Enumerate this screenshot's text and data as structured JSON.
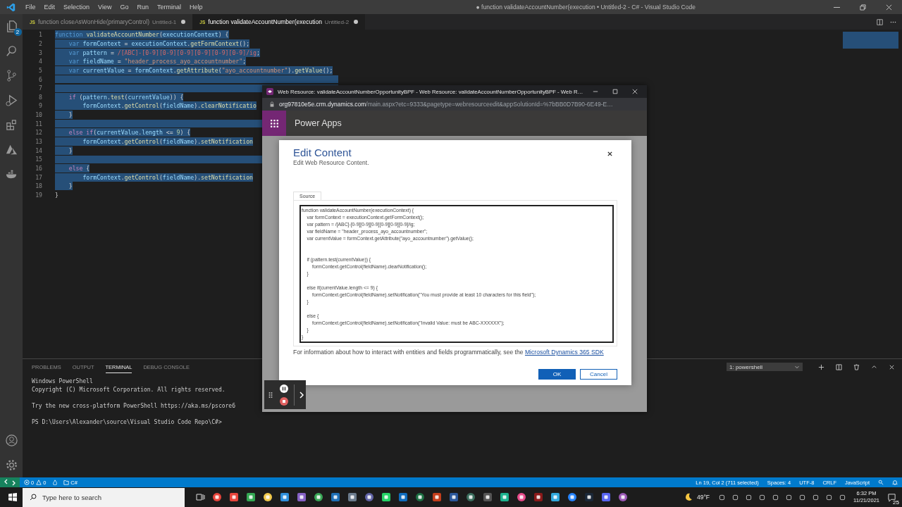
{
  "title_bar": {
    "menus": [
      "File",
      "Edit",
      "Selection",
      "View",
      "Go",
      "Run",
      "Terminal",
      "Help"
    ],
    "title": "● function validateAccountNumber(execution • Untitled-2 - C# - Visual Studio Code"
  },
  "activity_bar": {
    "explorer_badge": "2"
  },
  "editor": {
    "tabs": [
      {
        "badge": "JS",
        "label": "function closeAsWonHide(primaryControl)",
        "file": "Untitled-1",
        "modified": true,
        "selected": false
      },
      {
        "badge": "JS",
        "label": "function validateAccountNumber(execution",
        "file": "Untitled-2",
        "modified": true,
        "selected": true
      }
    ],
    "lines": [
      {
        "number": "1",
        "selected": true,
        "tokens": [
          {
            "kind": "kw",
            "text": "function "
          },
          {
            "kind": "fn",
            "text": "validateAccountNumber"
          },
          {
            "kind": "pl",
            "text": "("
          },
          {
            "kind": "var",
            "text": "executionContext"
          },
          {
            "kind": "pl",
            "text": ") {"
          }
        ]
      },
      {
        "number": "2",
        "selected": true,
        "tokens": [
          {
            "kind": "kw",
            "text": "    var "
          },
          {
            "kind": "var",
            "text": "formContext"
          },
          {
            "kind": "pl",
            "text": " = "
          },
          {
            "kind": "var",
            "text": "executionContext"
          },
          {
            "kind": "pl",
            "text": "."
          },
          {
            "kind": "fn",
            "text": "getFormContext"
          },
          {
            "kind": "pl",
            "text": "();"
          }
        ]
      },
      {
        "number": "3",
        "selected": true,
        "tokens": [
          {
            "kind": "kw",
            "text": "    var "
          },
          {
            "kind": "var",
            "text": "pattern"
          },
          {
            "kind": "pl",
            "text": " = "
          },
          {
            "kind": "re",
            "text": "/[ABC]-[0-9][0-9][0-9][0-9][0-9][0-9]/ig"
          },
          {
            "kind": "pl",
            "text": ";"
          }
        ]
      },
      {
        "number": "4",
        "selected": true,
        "tokens": [
          {
            "kind": "kw",
            "text": "    var "
          },
          {
            "kind": "var",
            "text": "fieldName"
          },
          {
            "kind": "pl",
            "text": " = "
          },
          {
            "kind": "str",
            "text": "\"header_process_ayo_accountnumber\""
          },
          {
            "kind": "pl",
            "text": ";"
          }
        ]
      },
      {
        "number": "5",
        "selected": true,
        "tokens": [
          {
            "kind": "kw",
            "text": "    var "
          },
          {
            "kind": "var",
            "text": "currentValue"
          },
          {
            "kind": "pl",
            "text": " = "
          },
          {
            "kind": "var",
            "text": "formContext"
          },
          {
            "kind": "pl",
            "text": "."
          },
          {
            "kind": "fn",
            "text": "getAttribute"
          },
          {
            "kind": "pl",
            "text": "("
          },
          {
            "kind": "str",
            "text": "\"ayo_accountnumber\""
          },
          {
            "kind": "pl",
            "text": ")."
          },
          {
            "kind": "fn",
            "text": "getValue"
          },
          {
            "kind": "pl",
            "text": "();"
          }
        ]
      },
      {
        "number": "6",
        "selected": true
      },
      {
        "number": "7",
        "selected": true
      },
      {
        "number": "8",
        "selected": true,
        "tokens": [
          {
            "kind": "ctl",
            "text": "    if"
          },
          {
            "kind": "pl",
            "text": " ("
          },
          {
            "kind": "var",
            "text": "pattern"
          },
          {
            "kind": "pl",
            "text": "."
          },
          {
            "kind": "fn",
            "text": "test"
          },
          {
            "kind": "pl",
            "text": "("
          },
          {
            "kind": "var",
            "text": "currentValue"
          },
          {
            "kind": "pl",
            "text": ")) {"
          }
        ]
      },
      {
        "number": "9",
        "selected": true,
        "tokens": [
          {
            "kind": "var",
            "text": "        formContext"
          },
          {
            "kind": "pl",
            "text": "."
          },
          {
            "kind": "fn",
            "text": "getControl"
          },
          {
            "kind": "pl",
            "text": "("
          },
          {
            "kind": "var",
            "text": "fieldName"
          },
          {
            "kind": "pl",
            "text": ")."
          },
          {
            "kind": "fn",
            "text": "clearNotificatio"
          }
        ]
      },
      {
        "number": "10",
        "selected": true,
        "tokens": [
          {
            "kind": "pl",
            "text": "    }"
          }
        ]
      },
      {
        "number": "11",
        "selected": true
      },
      {
        "number": "12",
        "selected": true,
        "tokens": [
          {
            "kind": "ctl",
            "text": "    else if"
          },
          {
            "kind": "pl",
            "text": "("
          },
          {
            "kind": "var",
            "text": "currentValue"
          },
          {
            "kind": "pl",
            "text": "."
          },
          {
            "kind": "var",
            "text": "length"
          },
          {
            "kind": "pl",
            "text": " <= "
          },
          {
            "kind": "num",
            "text": "9"
          },
          {
            "kind": "pl",
            "text": ") {"
          }
        ]
      },
      {
        "number": "13",
        "selected": true,
        "tokens": [
          {
            "kind": "var",
            "text": "        formContext"
          },
          {
            "kind": "pl",
            "text": "."
          },
          {
            "kind": "fn",
            "text": "getControl"
          },
          {
            "kind": "pl",
            "text": "("
          },
          {
            "kind": "var",
            "text": "fieldName"
          },
          {
            "kind": "pl",
            "text": ")."
          },
          {
            "kind": "fn",
            "text": "setNotification"
          }
        ]
      },
      {
        "number": "14",
        "selected": true,
        "tokens": [
          {
            "kind": "pl",
            "text": "    }"
          }
        ]
      },
      {
        "number": "15",
        "selected": true
      },
      {
        "number": "16",
        "selected": true,
        "tokens": [
          {
            "kind": "ctl",
            "text": "    else"
          },
          {
            "kind": "pl",
            "text": " {"
          }
        ]
      },
      {
        "number": "17",
        "selected": true,
        "tokens": [
          {
            "kind": "var",
            "text": "        formContext"
          },
          {
            "kind": "pl",
            "text": "."
          },
          {
            "kind": "fn",
            "text": "getControl"
          },
          {
            "kind": "pl",
            "text": "("
          },
          {
            "kind": "var",
            "text": "fieldName"
          },
          {
            "kind": "pl",
            "text": ")."
          },
          {
            "kind": "fn",
            "text": "setNotification"
          }
        ]
      },
      {
        "number": "18",
        "selected": true,
        "tokens": [
          {
            "kind": "pl",
            "text": "    }"
          }
        ]
      },
      {
        "number": "19",
        "selected": false,
        "tokens": [
          {
            "kind": "pl",
            "text": "}"
          }
        ]
      }
    ]
  },
  "browser_window": {
    "title": "Web Resource: validateAccountNumberOpportunityBPF - Web Resource: validateAccountNumberOpportunityBPF - Web R…",
    "host": "org97810e5e.crm.dynamics.com",
    "path": "/main.aspx?etc=9333&pagetype=webresourceedit&appSolutionId=%7bBB0D7B90-6E49-E…",
    "app_name": "Power Apps",
    "dialog": {
      "title": "Edit Content",
      "subtitle": "Edit Web Resource Content.",
      "tabs": [
        {
          "label": "Source",
          "selected": true
        }
      ],
      "code": "function validateAccountNumber(executionContext) {\n    var formContext = executionContext.getFormContext();\n    var pattern = /[ABC]-[0-9][0-9][0-9][0-9][0-9][0-9]/ig;\n    var fieldName = \"header_process_ayo_accountnumber\";\n    var currentValue = formContext.getAttribute(\"ayo_accountnumber\").getValue();\n\n\n    if (pattern.test(currentValue)) {\n        formContext.getControl(fieldName).clearNotification();\n    }\n\n    else if(currentValue.length <= 9) {\n        formContext.getControl(fieldName).setNotification(\"You must provide at least 10 characters for this field\");\n    }\n\n    else {\n        formContext.getControl(fieldName).setNotification(\"Invalid Value: must be ABC-XXXXXX\");\n    }\n}",
      "info": "For information about how to interact with entities and fields programmatically, see the",
      "link": "Microsoft Dynamics 365 SDK",
      "buttons": [
        {
          "label": "OK",
          "kind": "primary"
        },
        {
          "label": "Cancel",
          "kind": "secondary"
        }
      ]
    }
  },
  "panel": {
    "tabs": [
      {
        "label": "PROBLEMS",
        "selected": false
      },
      {
        "label": "OUTPUT",
        "selected": false
      },
      {
        "label": "TERMINAL",
        "selected": true
      },
      {
        "label": "DEBUG CONSOLE",
        "selected": false
      }
    ],
    "terminal_select": "1: powershell",
    "terminal": "Windows PowerShell\nCopyright (C) Microsoft Corporation. All rights reserved.\n\nTry the new cross-platform PowerShell https://aka.ms/pscore6\n\nPS D:\\Users\\Alexander\\source\\Visual Studio Code Repo\\C#>"
  },
  "status_bar": {
    "errors": "0",
    "warnings": "0",
    "folder": "C#",
    "right": [
      "Ln 19, Col 2 (711 selected)",
      "Spaces: 4",
      "UTF-8",
      "CRLF",
      "JavaScript"
    ]
  },
  "taskbar": {
    "search_placeholder": "Type here to search",
    "weather": "49°F",
    "time": "6:32 PM",
    "date": "11/21/2021",
    "notifications": "25"
  }
}
